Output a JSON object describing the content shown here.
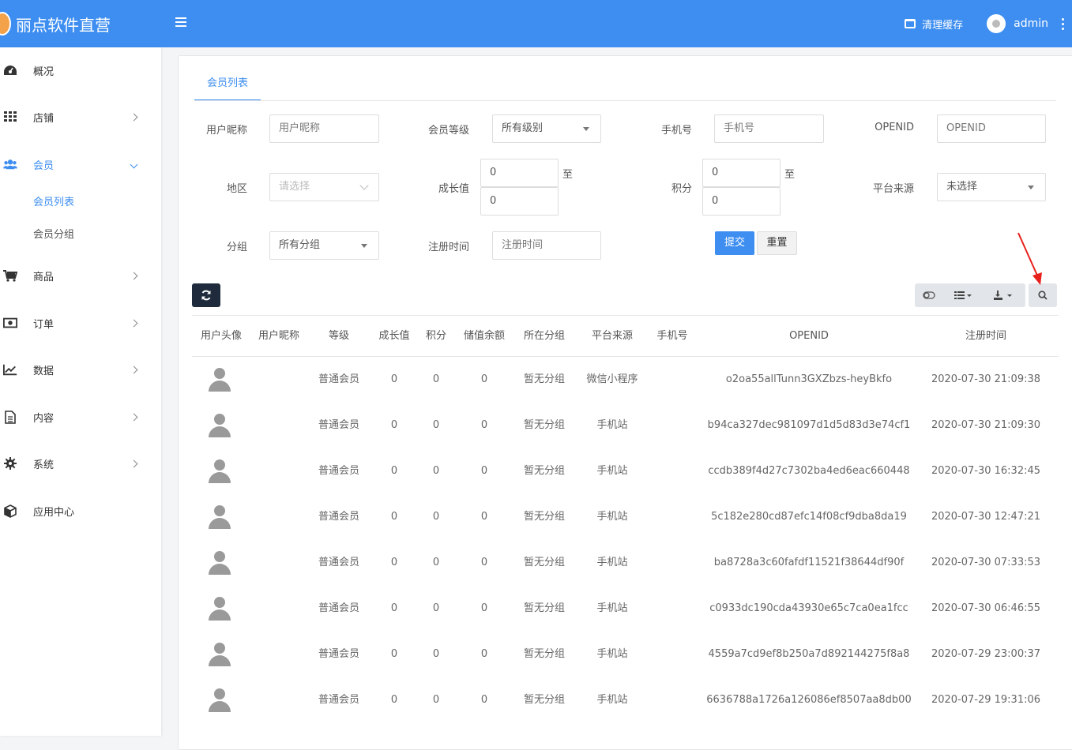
{
  "app": {
    "brand": "丽点软件直营",
    "cache_label": "清理缓存",
    "username": "admin"
  },
  "sidebar": {
    "items": [
      {
        "label": "概况",
        "icon": "dashboard-icon",
        "chevron": false
      },
      {
        "label": "店铺",
        "icon": "grid-icon",
        "chevron": true
      },
      {
        "label": "会员",
        "icon": "users-icon",
        "chevron": true,
        "active": true
      },
      {
        "label": "商品",
        "icon": "cart-icon",
        "chevron": true
      },
      {
        "label": "订单",
        "icon": "money-icon",
        "chevron": true
      },
      {
        "label": "数据",
        "icon": "chart-icon",
        "chevron": true
      },
      {
        "label": "内容",
        "icon": "document-icon",
        "chevron": true
      },
      {
        "label": "系统",
        "icon": "gear-icon",
        "chevron": true
      },
      {
        "label": "应用中心",
        "icon": "cube-icon",
        "chevron": false
      }
    ],
    "subitems": [
      {
        "label": "会员列表",
        "active": true
      },
      {
        "label": "会员分组",
        "active": false
      }
    ]
  },
  "tab": {
    "label": "会员列表"
  },
  "filters": {
    "nickname_label": "用户昵称",
    "nickname_placeholder": "用户昵称",
    "level_label": "会员等级",
    "level_value": "所有级别",
    "phone_label": "手机号",
    "phone_placeholder": "手机号",
    "openid_label": "OPENID",
    "openid_placeholder": "OPENID",
    "region_label": "地区",
    "region_placeholder": "请选择",
    "growth_label": "成长值",
    "growth_min": "0",
    "growth_max": "0",
    "points_label": "积分",
    "points_min": "0",
    "points_max": "0",
    "to_label": "至",
    "source_label": "平台来源",
    "source_value": "未选择",
    "group_label": "分组",
    "group_value": "所有分组",
    "regtime_label": "注册时间",
    "regtime_placeholder": "注册时间",
    "submit_label": "提交",
    "reset_label": "重置"
  },
  "table": {
    "headers": [
      "用户头像",
      "用户昵称",
      "等级",
      "成长值",
      "积分",
      "储值余额",
      "所在分组",
      "平台来源",
      "手机号",
      "OPENID",
      "注册时间"
    ],
    "rows": [
      {
        "level": "普通会员",
        "growth": "0",
        "points": "0",
        "balance": "0",
        "group": "暂无分组",
        "source": "微信小程序",
        "phone": "",
        "openid": "o2oa55allTunn3GXZbzs-heyBkfo",
        "regtime": "2020-07-30 21:09:38"
      },
      {
        "level": "普通会员",
        "growth": "0",
        "points": "0",
        "balance": "0",
        "group": "暂无分组",
        "source": "手机站",
        "phone": "",
        "openid": "b94ca327dec981097d1d5d83d3e74cf1",
        "regtime": "2020-07-30 21:09:30"
      },
      {
        "level": "普通会员",
        "growth": "0",
        "points": "0",
        "balance": "0",
        "group": "暂无分组",
        "source": "手机站",
        "phone": "",
        "openid": "ccdb389f4d27c7302ba4ed6eac660448",
        "regtime": "2020-07-30 16:32:45"
      },
      {
        "level": "普通会员",
        "growth": "0",
        "points": "0",
        "balance": "0",
        "group": "暂无分组",
        "source": "手机站",
        "phone": "",
        "openid": "5c182e280cd87efc14f08cf9dba8da19",
        "regtime": "2020-07-30 12:47:21"
      },
      {
        "level": "普通会员",
        "growth": "0",
        "points": "0",
        "balance": "0",
        "group": "暂无分组",
        "source": "手机站",
        "phone": "",
        "openid": "ba8728a3c60fafdf11521f38644df90f",
        "regtime": "2020-07-30 07:33:53"
      },
      {
        "level": "普通会员",
        "growth": "0",
        "points": "0",
        "balance": "0",
        "group": "暂无分组",
        "source": "手机站",
        "phone": "",
        "openid": "c0933dc190cda43930e65c7ca0ea1fcc",
        "regtime": "2020-07-30 06:46:55"
      },
      {
        "level": "普通会员",
        "growth": "0",
        "points": "0",
        "balance": "0",
        "group": "暂无分组",
        "source": "手机站",
        "phone": "",
        "openid": "4559a7cd9ef8b250a7d892144275f8a8",
        "regtime": "2020-07-29 23:00:37"
      },
      {
        "level": "普通会员",
        "growth": "0",
        "points": "0",
        "balance": "0",
        "group": "暂无分组",
        "source": "手机站",
        "phone": "",
        "openid": "6636788a1726a126086ef8507aa8db00",
        "regtime": "2020-07-29 19:31:06"
      }
    ]
  },
  "colors": {
    "accent": "#3d8ef0",
    "topbar": "#3d8ef0",
    "refresh_button": "#1f2b3c",
    "arrow": "#e8201c"
  }
}
